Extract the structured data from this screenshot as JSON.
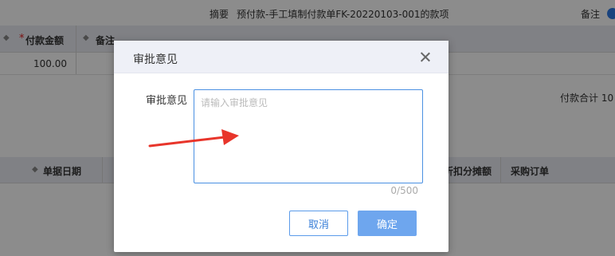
{
  "background": {
    "summary_label": "摘要",
    "summary_value": "预付款-手工填制付款单FK-20220103-001的款项",
    "remark_label": "备注",
    "grid1": {
      "required_mark": "*",
      "amount_header": "付款金额",
      "remark_header": "备注",
      "amount_value": "100.00"
    },
    "total_label": "付款合计",
    "total_value": "10",
    "grid2": {
      "date_header": "单据日期",
      "discount_header": "折扣分摊额",
      "po_header": "采购订单"
    }
  },
  "dialog": {
    "title": "审批意见",
    "field_label": "审批意见",
    "textarea_value": "",
    "textarea_placeholder": "请输入审批意见",
    "counter": "0/500",
    "cancel_label": "取消",
    "ok_label": "确定"
  },
  "colors": {
    "overlay": "rgba(0,0,0,0.45)",
    "primary": "#6ea6ee",
    "primary_border": "#5b9bea",
    "arrow": "#e8352b"
  }
}
